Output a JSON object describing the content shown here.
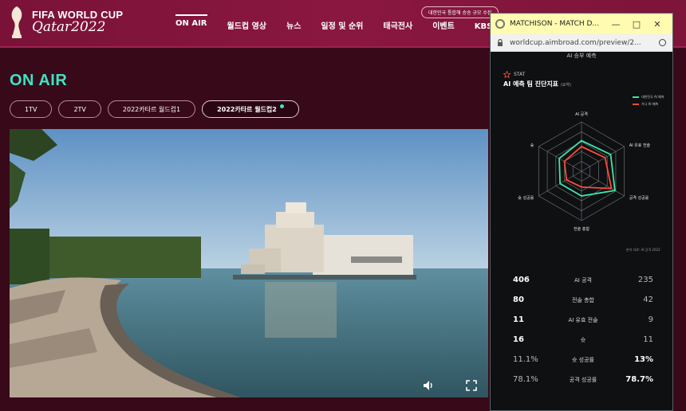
{
  "header": {
    "logo": {
      "line1": "FIFA WORLD CUP",
      "line2": "Qatar2022",
      "icon": "trophy-icon"
    },
    "badge": "대한민국 통합해 승승 규모 수집",
    "nav": [
      "ON AIR",
      "월드컵 영상",
      "뉴스",
      "일정 및 순위",
      "태극전사",
      "이벤트",
      "KBS홈"
    ]
  },
  "page": {
    "title": "ON AIR",
    "channels": [
      "1TV",
      "2TV",
      "2022카타르 월드컵1",
      "2022카타르 월드컵2"
    ],
    "active_channel": "2022카타르 월드컵2"
  },
  "player": {
    "volume_icon": "volume-icon",
    "fullscreen_icon": "fullscreen-icon"
  },
  "popup": {
    "window_title": "MATCHISON - MATCH D...",
    "controls": [
      "—",
      "□",
      "✕"
    ],
    "url": "worldcup.aimbroad.com/preview/2...",
    "section_top": "AI 승부 예측",
    "stat_label": "STAT",
    "stat_title": "AI 예측 팀 진단지표",
    "stat_title_small": "(요약)",
    "legend": [
      "대한민국 AI 예측",
      "가나 AI 예측"
    ],
    "legend_colors": [
      "#3ee6a8",
      "#ff4a3a"
    ],
    "radar_labels": [
      "AI 공격",
      "AI 유효 전술",
      "공격 성공률",
      "전술 총합",
      "슛 성공률",
      "슛"
    ],
    "radar_series": [
      {
        "values": [
          0.62,
          0.68,
          0.78,
          0.5,
          0.5,
          0.52
        ]
      },
      {
        "values": [
          0.5,
          0.55,
          0.7,
          0.32,
          0.35,
          0.4
        ]
      }
    ],
    "radar_note": "분석 자료: AI 공격 2022",
    "stats": [
      {
        "left": "406",
        "label": "AI 공격",
        "right": "235",
        "left_bold": true,
        "right_bold": false
      },
      {
        "left": "80",
        "label": "전술 총합",
        "right": "42",
        "left_bold": true,
        "right_bold": false
      },
      {
        "left": "11",
        "label": "AI 유효 전술",
        "right": "9",
        "left_bold": true,
        "right_bold": false
      },
      {
        "left": "16",
        "label": "슛",
        "right": "11",
        "left_bold": true,
        "right_bold": false
      },
      {
        "left": "11.1%",
        "label": "슛 성공률",
        "right": "13%",
        "left_bold": false,
        "right_bold": true
      },
      {
        "left": "78.1%",
        "label": "공격 성공률",
        "right": "78.7%",
        "left_bold": false,
        "right_bold": true
      }
    ]
  }
}
